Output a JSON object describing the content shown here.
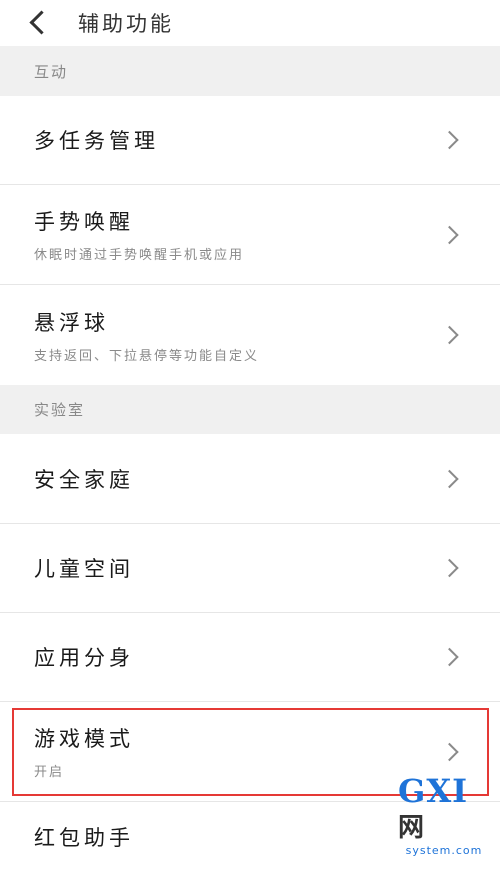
{
  "header": {
    "title": "辅助功能"
  },
  "sections": {
    "interaction": "互动",
    "lab": "实验室"
  },
  "items": {
    "multitask": {
      "label": "多任务管理"
    },
    "gesture": {
      "label": "手势唤醒",
      "sub": "休眠时通过手势唤醒手机或应用"
    },
    "floatball": {
      "label": "悬浮球",
      "sub": "支持返回、下拉悬停等功能自定义"
    },
    "safehome": {
      "label": "安全家庭"
    },
    "kidspace": {
      "label": "儿童空间"
    },
    "appclone": {
      "label": "应用分身"
    },
    "gamemode": {
      "label": "游戏模式",
      "sub": "开启"
    },
    "redpacket": {
      "label": "红包助手"
    }
  },
  "watermark": {
    "main": "GXI",
    "net": "网",
    "sub": "system.com"
  },
  "colors": {
    "highlight": "#e53935",
    "watermark": "#1e73d8"
  }
}
